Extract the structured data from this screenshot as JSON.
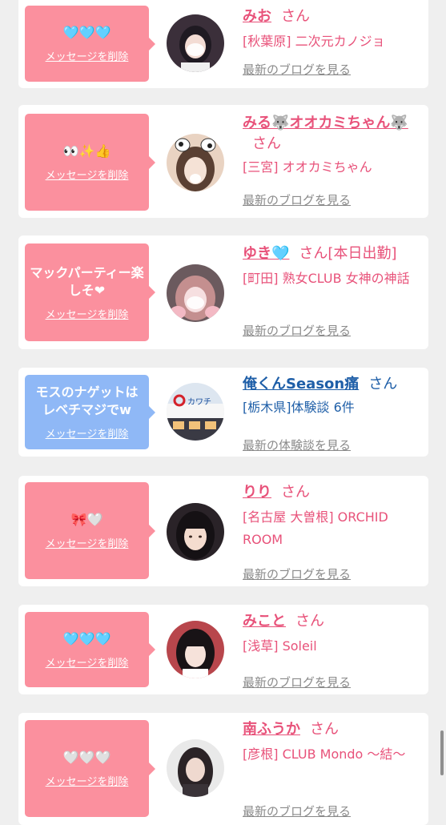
{
  "common": {
    "delete_label": "メッセージを削除",
    "san": "さん",
    "blog_link": "最新のブログを見る",
    "review_link": "最新の体験談を見る"
  },
  "messages": [
    {
      "text": "🩵🩵🩵",
      "name": "みお",
      "status": "",
      "shop": "[秋葉原] 二次元カノジョ",
      "link_type": "blog"
    },
    {
      "text": "👀✨👍",
      "name": "みる🐺オオカミちゃん🐺",
      "status": "",
      "shop": "[三宮] オオカミちゃん",
      "link_type": "blog"
    },
    {
      "text": "マックパーティー楽しそ❤",
      "name": "ゆき🩵",
      "status": "[本日出勤]",
      "shop": "[町田] 熟女CLUB 女神の神話",
      "link_type": "blog"
    },
    {
      "text": "モスのナゲットはレベチマジでw",
      "name": "俺くんSeason痛",
      "status": "",
      "shop": "[栃木県]体験談 6件",
      "link_type": "review"
    },
    {
      "text": "🎀🤍",
      "name": "りり",
      "status": "",
      "shop": "[名古屋 大曽根] ORCHID ROOM",
      "link_type": "blog"
    },
    {
      "text": "🩵🩵🩵",
      "name": "みこと",
      "status": "",
      "shop": "[浅草] Soleil",
      "link_type": "blog"
    },
    {
      "text": "🤍🤍🤍",
      "name": "南ふうか",
      "status": "",
      "shop": "[彦根] CLUB Mondo 〜結〜",
      "link_type": "blog"
    }
  ],
  "avatar_store_logo": "カワチ"
}
